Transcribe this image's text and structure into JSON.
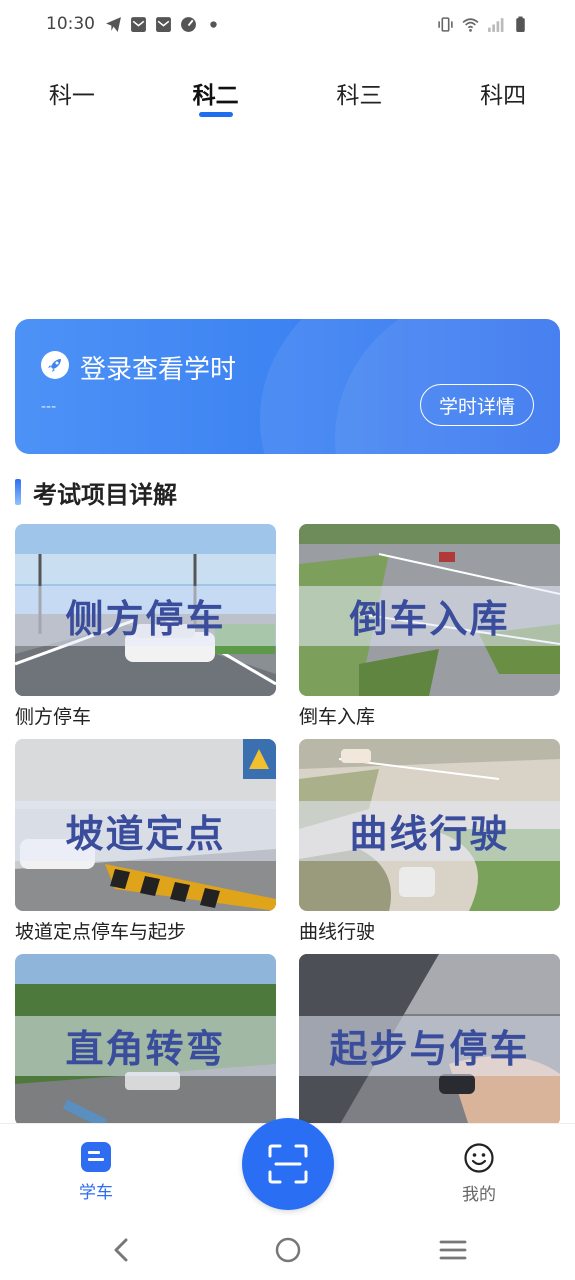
{
  "status_bar": {
    "time": "10:30"
  },
  "tabs": [
    {
      "label": "科一",
      "active": false
    },
    {
      "label": "科二",
      "active": true
    },
    {
      "label": "科三",
      "active": false
    },
    {
      "label": "科四",
      "active": false
    }
  ],
  "banner": {
    "title": "登录查看学时",
    "subtitle": "---",
    "button_label": "学时详情"
  },
  "section": {
    "title": "考试项目详解"
  },
  "cards": [
    {
      "overlay": "侧方停车",
      "label": "侧方停车"
    },
    {
      "overlay": "倒车入库",
      "label": "倒车入库"
    },
    {
      "overlay": "坡道定点",
      "label": "坡道定点停车与起步"
    },
    {
      "overlay": "曲线行驶",
      "label": "曲线行驶"
    },
    {
      "overlay": "直角转弯",
      "label": ""
    },
    {
      "overlay": "起步与停车",
      "label": ""
    }
  ],
  "bottom_nav": {
    "learn_label": "学车",
    "mine_label": "我的"
  },
  "colors": {
    "accent": "#2a6ff3",
    "banner_start": "#4d92f6",
    "banner_end": "#2a6cee"
  }
}
